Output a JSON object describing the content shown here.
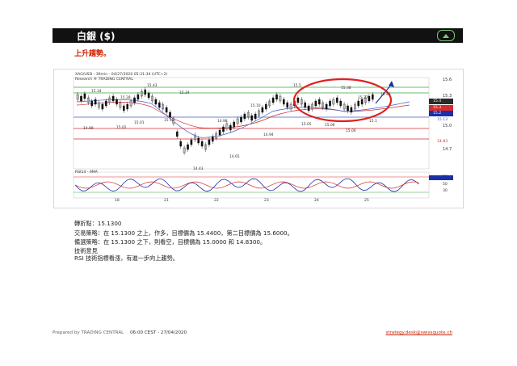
{
  "header": {
    "title": "白銀 ($)",
    "icon": "up-arrow-icon",
    "icon_color": "#7cc67c"
  },
  "subtitle": "上升趨勢。",
  "chart": {
    "line1": "XAG/USD - 30min - 04/27/2020 05:31:34 (UTC+2)",
    "line2": "Research ® TRADING CENTRAL",
    "price_axis": [
      "15.6",
      "15.3",
      "15.0",
      "14.7"
    ],
    "price_tags": [
      "15.4",
      "15.3",
      "15.2",
      "15.13",
      "14.83"
    ],
    "rsi_title": "RSI14 - 9MA",
    "rsi_axis": [
      "70",
      "50",
      "30"
    ],
    "time_labels": [
      "18",
      "21",
      "22",
      "23",
      "24",
      "25"
    ],
    "annotations": [
      "15.34",
      "15.28",
      "15.43",
      "15.34",
      "15.13",
      "15.10",
      "15.5",
      "15.38",
      "15.27",
      "15.43",
      "14.99",
      "15.02",
      "15.01",
      "14.98",
      "14.94",
      "14.65",
      "14.43",
      "15.05",
      "15.06",
      "15.00",
      "15.1"
    ],
    "colors": {
      "support": "#d62b2b",
      "pivot": "#3a5fcd",
      "resistance": "#3aa83a",
      "ellipse": "#e02020",
      "arrow": "#1a2fa8"
    }
  },
  "analysis": {
    "pivot": "轉折點：15.1300",
    "trade": "交易策略：在 15.1300 之上，作多，目標價為 15.4400，第二目標價為 15.6000。",
    "alt": "備選策略：在 15.1300 之下，則看空，目標價為 15.0000 和 14.8300。",
    "tech_title": "技術意見",
    "tech_text": "RSI 技術指標看漲，有進一步向上趨勢。"
  },
  "footer": {
    "prepared": "Prepared by TRADING CENTRAL",
    "time": "06:00 CEST - 27/04/2020",
    "email": "strategy.desk@swissquote.ch"
  }
}
